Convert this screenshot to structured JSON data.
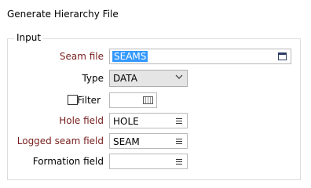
{
  "window": {
    "title": "Generate Hierarchy File"
  },
  "input_group": {
    "legend": "Input"
  },
  "form": {
    "seam_file": {
      "label": "Seam file",
      "value": "SEAMS"
    },
    "type": {
      "label": "Type",
      "value": "DATA"
    },
    "filter": {
      "label": "Filter",
      "checked": false,
      "value": ""
    },
    "hole_field": {
      "label": "Hole field",
      "value": "HOLE"
    },
    "logged_seam_field": {
      "label": "Logged seam field",
      "value": "SEAM"
    },
    "formation_field": {
      "label": "Formation field",
      "value": ""
    }
  },
  "colors": {
    "required_label": "#7a1e1e",
    "selection": "#3399ff",
    "combo_background": "#e5e5e5"
  },
  "icons": {
    "seam_file_browse": "browse-icon",
    "type_dropdown": "chevron-down-icon",
    "filter_edit": "filter-icon",
    "field_list": "list-icon"
  }
}
